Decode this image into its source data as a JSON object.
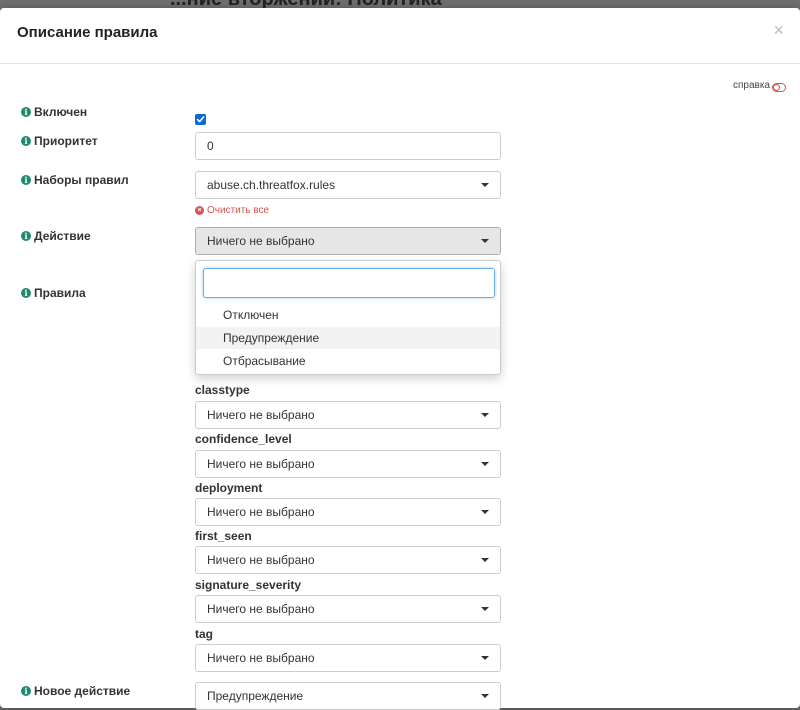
{
  "background": {
    "title": "...ние вторжений: Политика"
  },
  "modal": {
    "title": "Описание правила",
    "close_glyph": "×",
    "help_label": "справка"
  },
  "fields": {
    "enabled": {
      "label": "Включен",
      "checked": true
    },
    "priority": {
      "label": "Приоритет",
      "value": "0"
    },
    "rulesets": {
      "label": "Наборы правил",
      "value": "abuse.ch.threatfox.rules",
      "clear_label": "Очистить все"
    },
    "action": {
      "label": "Действие",
      "value": "Ничего не выбрано"
    },
    "rules": {
      "label": "Правила"
    },
    "new_action": {
      "label": "Новое действие",
      "value": "Предупреждение"
    }
  },
  "action_dropdown": {
    "search_value": "",
    "options": [
      "Отключен",
      "Предупреждение",
      "Отбрасывание"
    ],
    "hovered_index": 1
  },
  "metadata_filters": [
    {
      "label": "classtype",
      "value": "Ничего не выбрано"
    },
    {
      "label": "confidence_level",
      "value": "Ничего не выбрано"
    },
    {
      "label": "deployment",
      "value": "Ничего не выбрано"
    },
    {
      "label": "first_seen",
      "value": "Ничего не выбрано"
    },
    {
      "label": "signature_severity",
      "value": "Ничего не выбрано"
    },
    {
      "label": "tag",
      "value": "Ничего не выбрано"
    }
  ],
  "colors": {
    "accent": "#0b6ad6",
    "danger": "#d9534f",
    "info": "#1f8a70"
  },
  "icons": {
    "info": "info-icon",
    "clear": "clear-icon",
    "caret": "chevron-down-icon",
    "close": "close-icon"
  }
}
